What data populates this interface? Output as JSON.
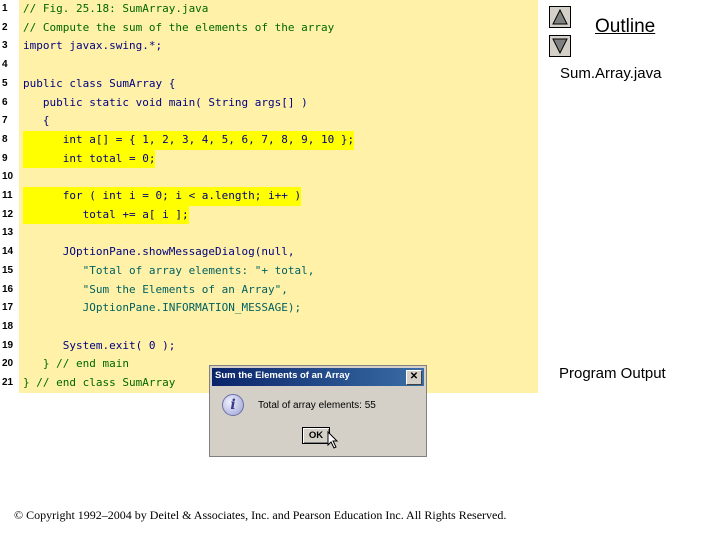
{
  "nav": {
    "outline_label": "Outline",
    "file_label": "Sum.Array.java",
    "output_label": "Program Output"
  },
  "code": {
    "lines": [
      {
        "n": "1",
        "t": "// Fig. 25.18: SumArray.java"
      },
      {
        "n": "2",
        "t": "// Compute the sum of the elements of the array"
      },
      {
        "n": "3",
        "t": "import javax.swing.*;"
      },
      {
        "n": "4",
        "t": ""
      },
      {
        "n": "5",
        "t": "public class SumArray {"
      },
      {
        "n": "6",
        "t": "   public static void main( String args[] )"
      },
      {
        "n": "7",
        "t": "   {"
      },
      {
        "n": "8",
        "t": "      int a[] = { 1, 2, 3, 4, 5, 6, 7, 8, 9, 10 };"
      },
      {
        "n": "9",
        "t": "      int total = 0;"
      },
      {
        "n": "10",
        "t": ""
      },
      {
        "n": "11",
        "t": "      for ( int i = 0; i < a.length; i++ )"
      },
      {
        "n": "12",
        "t": "         total += a[ i ];"
      },
      {
        "n": "13",
        "t": ""
      },
      {
        "n": "14",
        "t": "      JOptionPane.showMessageDialog(null,"
      },
      {
        "n": "15",
        "t": "         \"Total of array elements: \"+ total,"
      },
      {
        "n": "16",
        "t": "         \"Sum the Elements of an Array\","
      },
      {
        "n": "17",
        "t": "         JOptionPane.INFORMATION_MESSAGE);"
      },
      {
        "n": "18",
        "t": ""
      },
      {
        "n": "19",
        "t": "      System.exit( 0 );"
      },
      {
        "n": "20",
        "t": "   } // end main"
      },
      {
        "n": "21",
        "t": "} // end class SumArray"
      }
    ]
  },
  "dialog": {
    "title": "Sum the Elements of an Array",
    "message": "Total of array elements: 55",
    "ok_label": "OK",
    "close_glyph": "✕",
    "icon": "info-icon",
    "icon_glyph": "i"
  },
  "footer": {
    "copyright": "© Copyright 1992–2004 by Deitel & Associates, Inc. and Pearson Education Inc. All Rights Reserved."
  },
  "colors": {
    "code_bg": "#fff2a8",
    "highlight": "#ffff00",
    "titlebar": "#0a246a"
  }
}
